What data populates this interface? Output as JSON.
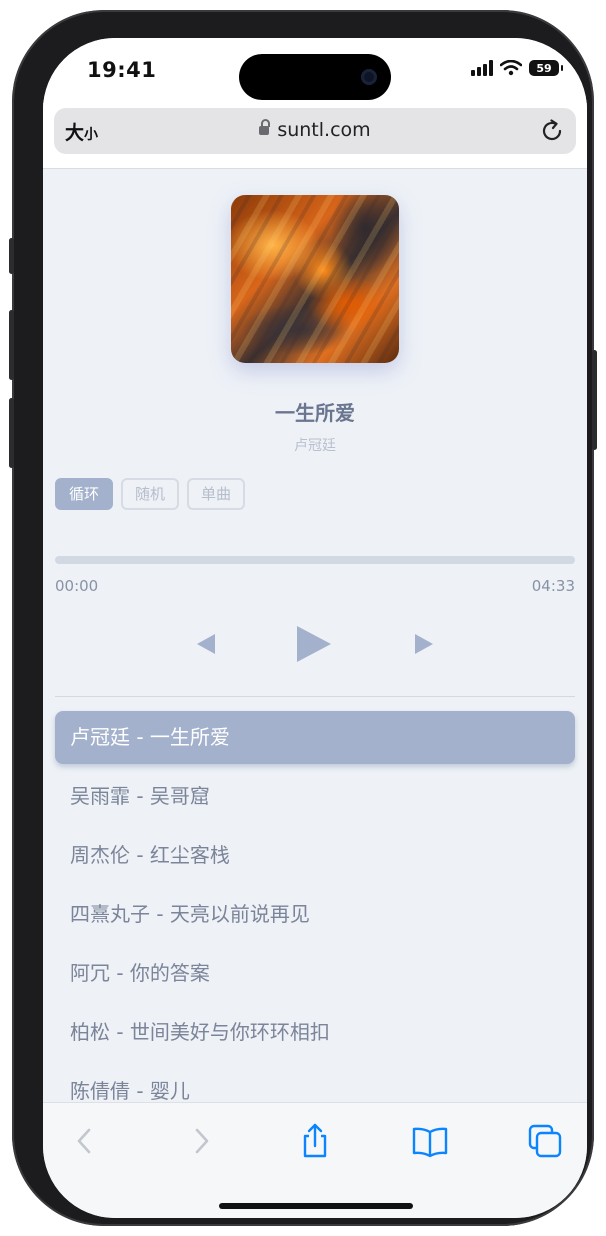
{
  "status_bar": {
    "time": "19:41",
    "battery": "59"
  },
  "browser": {
    "text_size_label": "大",
    "text_size_small": "小",
    "url": "suntl.com"
  },
  "player": {
    "title": "一生所爱",
    "artist": "卢冠廷",
    "modes": [
      {
        "label": "循环",
        "active": true
      },
      {
        "label": "随机",
        "active": false
      },
      {
        "label": "单曲",
        "active": false
      }
    ],
    "progress_fraction": 0,
    "current_time": "00:00",
    "total_time": "04:33"
  },
  "playlist": [
    {
      "label": "卢冠廷 - 一生所爱",
      "active": true
    },
    {
      "label": "吴雨霏 - 吴哥窟",
      "active": false
    },
    {
      "label": "周杰伦 - 红尘客栈",
      "active": false
    },
    {
      "label": "四熹丸子 - 天亮以前说再见",
      "active": false
    },
    {
      "label": "阿冗 - 你的答案",
      "active": false
    },
    {
      "label": "柏松 - 世间美好与你环环相扣",
      "active": false
    },
    {
      "label": "陈倩倩 - 婴儿",
      "active": false
    }
  ],
  "colors": {
    "accent": "#a3b1cc",
    "ios_blue": "#0a84ff",
    "background": "#eef2f7"
  },
  "icons": [
    "back-icon",
    "forward-icon",
    "share-icon",
    "bookmarks-icon",
    "tabs-icon",
    "reload-icon",
    "lock-icon",
    "play-icon",
    "prev-icon",
    "next-icon"
  ]
}
